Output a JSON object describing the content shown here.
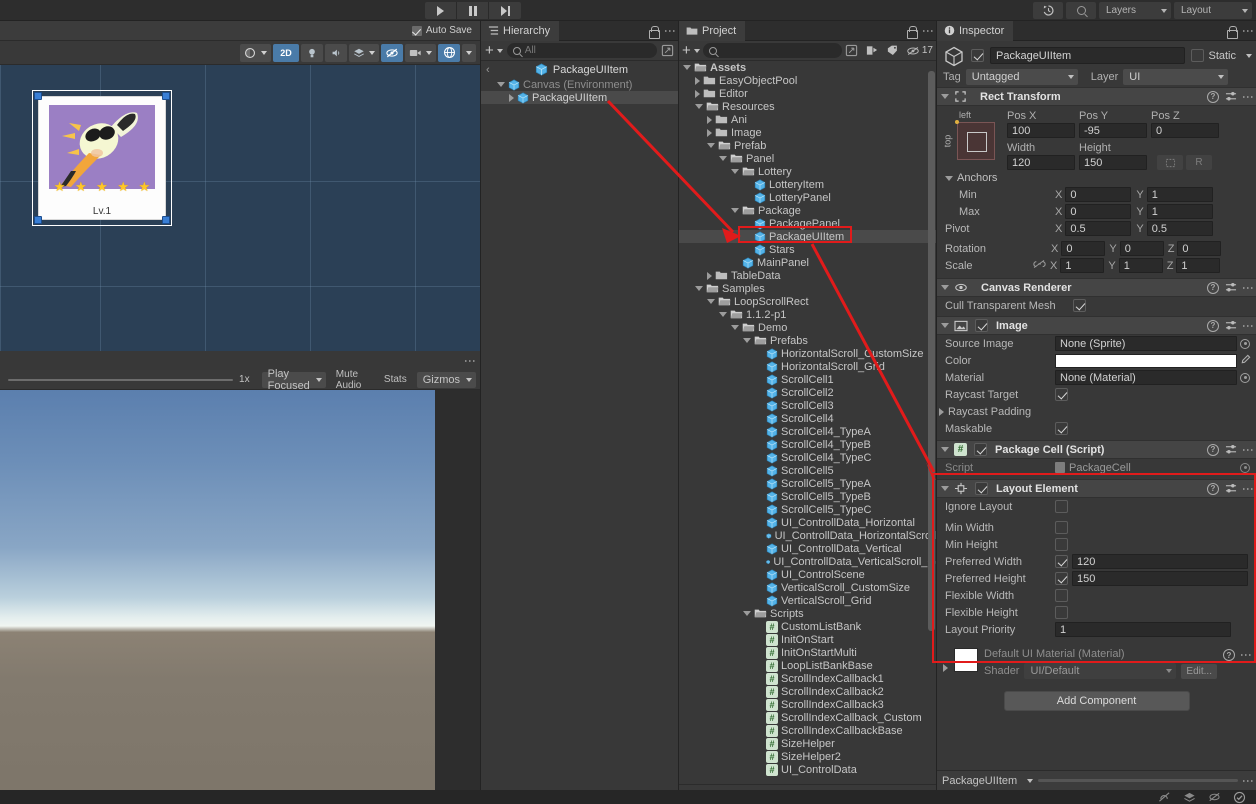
{
  "toolbar": {
    "play_label": "play-button",
    "pause_label": "pause-button",
    "step_label": "step-button",
    "history_icon": "history-icon",
    "search_icon": "search-icon",
    "layers_label": "Layers",
    "layout_label": "Layout"
  },
  "scene": {
    "auto_save_label": "Auto Save",
    "auto_save_checked": true,
    "mode_2d": "2D",
    "card": {
      "level_label": "Lv.1",
      "star_count": 5,
      "star_color": "#ffc727",
      "art_bg": "#9b7fc4"
    }
  },
  "game": {
    "zoom_label": "1x",
    "play_mode": "Play Focused",
    "mute_audio": "Mute Audio",
    "stats": "Stats",
    "gizmos": "Gizmos"
  },
  "hierarchy": {
    "tab_label": "Hierarchy",
    "search_placeholder": "All",
    "prefab_root": "PackageUIItem",
    "rows": [
      {
        "label": "Canvas (Environment)",
        "depth": 1,
        "tri": "down",
        "dim": true,
        "selected": false
      },
      {
        "label": "PackageUIItem",
        "depth": 2,
        "tri": "right",
        "dim": false,
        "selected": true
      }
    ]
  },
  "project": {
    "tab_label": "Project",
    "search_placeholder": "",
    "badge_count": "17",
    "rows": [
      {
        "label": "Assets",
        "depth": 0,
        "tri": "down",
        "icon": "folder-open",
        "selected": false
      },
      {
        "label": "EasyObjectPool",
        "depth": 1,
        "tri": "right",
        "icon": "folder",
        "selected": false
      },
      {
        "label": "Editor",
        "depth": 1,
        "tri": "right",
        "icon": "folder",
        "selected": false
      },
      {
        "label": "Resources",
        "depth": 1,
        "tri": "down",
        "icon": "folder-open",
        "selected": false
      },
      {
        "label": "Ani",
        "depth": 2,
        "tri": "right",
        "icon": "folder",
        "selected": false
      },
      {
        "label": "Image",
        "depth": 2,
        "tri": "right",
        "icon": "folder",
        "selected": false
      },
      {
        "label": "Prefab",
        "depth": 2,
        "tri": "down",
        "icon": "folder-open",
        "selected": false
      },
      {
        "label": "Panel",
        "depth": 3,
        "tri": "down",
        "icon": "folder-open",
        "selected": false
      },
      {
        "label": "Lottery",
        "depth": 4,
        "tri": "down",
        "icon": "folder-open",
        "selected": false
      },
      {
        "label": "LotteryItem",
        "depth": 5,
        "tri": "none",
        "icon": "prefab",
        "selected": false
      },
      {
        "label": "LotteryPanel",
        "depth": 5,
        "tri": "none",
        "icon": "prefab",
        "selected": false
      },
      {
        "label": "Package",
        "depth": 4,
        "tri": "down",
        "icon": "folder-open",
        "selected": false
      },
      {
        "label": "PackagePanel",
        "depth": 5,
        "tri": "none",
        "icon": "prefab",
        "selected": false
      },
      {
        "label": "PackageUIItem",
        "depth": 5,
        "tri": "none",
        "icon": "prefab",
        "selected": true
      },
      {
        "label": "Stars",
        "depth": 5,
        "tri": "none",
        "icon": "prefab",
        "selected": false
      },
      {
        "label": "MainPanel",
        "depth": 4,
        "tri": "none",
        "icon": "prefab",
        "selected": false
      },
      {
        "label": "TableData",
        "depth": 2,
        "tri": "right",
        "icon": "folder",
        "selected": false
      },
      {
        "label": "Samples",
        "depth": 1,
        "tri": "down",
        "icon": "folder-open",
        "selected": false
      },
      {
        "label": "LoopScrollRect",
        "depth": 2,
        "tri": "down",
        "icon": "folder-open",
        "selected": false
      },
      {
        "label": "1.1.2-p1",
        "depth": 3,
        "tri": "down",
        "icon": "folder-open",
        "selected": false
      },
      {
        "label": "Demo",
        "depth": 4,
        "tri": "down",
        "icon": "folder-open",
        "selected": false
      },
      {
        "label": "Prefabs",
        "depth": 5,
        "tri": "down",
        "icon": "folder-open",
        "selected": false
      },
      {
        "label": "HorizontalScroll_CustomSize",
        "depth": 6,
        "tri": "none",
        "icon": "prefab",
        "selected": false
      },
      {
        "label": "HorizontalScroll_Grid",
        "depth": 6,
        "tri": "none",
        "icon": "prefab",
        "selected": false
      },
      {
        "label": "ScrollCell1",
        "depth": 6,
        "tri": "none",
        "icon": "prefab",
        "selected": false
      },
      {
        "label": "ScrollCell2",
        "depth": 6,
        "tri": "none",
        "icon": "prefab",
        "selected": false
      },
      {
        "label": "ScrollCell3",
        "depth": 6,
        "tri": "none",
        "icon": "prefab",
        "selected": false
      },
      {
        "label": "ScrollCell4",
        "depth": 6,
        "tri": "none",
        "icon": "prefab",
        "selected": false
      },
      {
        "label": "ScrollCell4_TypeA",
        "depth": 6,
        "tri": "none",
        "icon": "prefab",
        "selected": false
      },
      {
        "label": "ScrollCell4_TypeB",
        "depth": 6,
        "tri": "none",
        "icon": "prefab",
        "selected": false
      },
      {
        "label": "ScrollCell4_TypeC",
        "depth": 6,
        "tri": "none",
        "icon": "prefab",
        "selected": false
      },
      {
        "label": "ScrollCell5",
        "depth": 6,
        "tri": "none",
        "icon": "prefab",
        "selected": false
      },
      {
        "label": "ScrollCell5_TypeA",
        "depth": 6,
        "tri": "none",
        "icon": "prefab",
        "selected": false
      },
      {
        "label": "ScrollCell5_TypeB",
        "depth": 6,
        "tri": "none",
        "icon": "prefab",
        "selected": false
      },
      {
        "label": "ScrollCell5_TypeC",
        "depth": 6,
        "tri": "none",
        "icon": "prefab",
        "selected": false
      },
      {
        "label": "UI_ControllData_Horizontal",
        "depth": 6,
        "tri": "none",
        "icon": "prefab",
        "selected": false
      },
      {
        "label": "UI_ControllData_HorizontalScroll",
        "depth": 6,
        "tri": "none",
        "icon": "prefab",
        "selected": false
      },
      {
        "label": "UI_ControllData_Vertical",
        "depth": 6,
        "tri": "none",
        "icon": "prefab",
        "selected": false
      },
      {
        "label": "UI_ControllData_VerticalScroll_G",
        "depth": 6,
        "tri": "none",
        "icon": "prefab",
        "selected": false
      },
      {
        "label": "UI_ControlScene",
        "depth": 6,
        "tri": "none",
        "icon": "prefab",
        "selected": false
      },
      {
        "label": "VerticalScroll_CustomSize",
        "depth": 6,
        "tri": "none",
        "icon": "prefab",
        "selected": false
      },
      {
        "label": "VerticalScroll_Grid",
        "depth": 6,
        "tri": "none",
        "icon": "prefab",
        "selected": false
      },
      {
        "label": "Scripts",
        "depth": 5,
        "tri": "down",
        "icon": "folder-open",
        "selected": false
      },
      {
        "label": "CustomListBank",
        "depth": 6,
        "tri": "none",
        "icon": "script",
        "selected": false
      },
      {
        "label": "InitOnStart",
        "depth": 6,
        "tri": "none",
        "icon": "script",
        "selected": false
      },
      {
        "label": "InitOnStartMulti",
        "depth": 6,
        "tri": "none",
        "icon": "script",
        "selected": false
      },
      {
        "label": "LoopListBankBase",
        "depth": 6,
        "tri": "none",
        "icon": "script",
        "selected": false
      },
      {
        "label": "ScrollIndexCallback1",
        "depth": 6,
        "tri": "none",
        "icon": "script",
        "selected": false
      },
      {
        "label": "ScrollIndexCallback2",
        "depth": 6,
        "tri": "none",
        "icon": "script",
        "selected": false
      },
      {
        "label": "ScrollIndexCallback3",
        "depth": 6,
        "tri": "none",
        "icon": "script",
        "selected": false
      },
      {
        "label": "ScrollIndexCallback_Custom",
        "depth": 6,
        "tri": "none",
        "icon": "script",
        "selected": false
      },
      {
        "label": "ScrollIndexCallbackBase",
        "depth": 6,
        "tri": "none",
        "icon": "script",
        "selected": false
      },
      {
        "label": "SizeHelper",
        "depth": 6,
        "tri": "none",
        "icon": "script",
        "selected": false
      },
      {
        "label": "SizeHelper2",
        "depth": 6,
        "tri": "none",
        "icon": "script",
        "selected": false
      },
      {
        "label": "UI_ControlData",
        "depth": 6,
        "tri": "none",
        "icon": "script",
        "selected": false
      }
    ]
  },
  "inspector": {
    "tab_label": "Inspector",
    "object_name": "PackageUIItem",
    "object_enabled": true,
    "static_label": "Static",
    "tag_label": "Tag",
    "tag_value": "Untagged",
    "layer_label": "Layer",
    "layer_value": "UI",
    "rect_transform": {
      "title": "Rect Transform",
      "anchor_left": "left",
      "anchor_top": "top",
      "pos_x_label": "Pos X",
      "pos_x": "100",
      "pos_y_label": "Pos Y",
      "pos_y": "-95",
      "pos_z_label": "Pos Z",
      "pos_z": "0",
      "width_label": "Width",
      "width": "120",
      "height_label": "Height",
      "height": "150",
      "anchors_label": "Anchors",
      "min_label": "Min",
      "min_x": "0",
      "min_y": "1",
      "max_label": "Max",
      "max_x": "0",
      "max_y": "1",
      "pivot_label": "Pivot",
      "pivot_x": "0.5",
      "pivot_y": "0.5",
      "rotation_label": "Rotation",
      "rot_x": "0",
      "rot_y": "0",
      "rot_z": "0",
      "scale_label": "Scale",
      "scale_x": "1",
      "scale_y": "1",
      "scale_z": "1",
      "blueprint_btn": "blueprint-mode-button",
      "raw_btn": "R"
    },
    "canvas_renderer": {
      "title": "Canvas Renderer",
      "cull_label": "Cull Transparent Mesh",
      "cull_checked": true
    },
    "image": {
      "title": "Image",
      "enabled": true,
      "source_image_label": "Source Image",
      "source_image_value": "None (Sprite)",
      "color_label": "Color",
      "color_value": "#ffffff",
      "material_label": "Material",
      "material_value": "None (Material)",
      "raycast_target_label": "Raycast Target",
      "raycast_target_checked": true,
      "raycast_padding_label": "Raycast Padding",
      "maskable_label": "Maskable",
      "maskable_checked": true
    },
    "package_cell": {
      "title": "Package Cell (Script)",
      "enabled": true,
      "script_label": "Script",
      "script_value": "PackageCell"
    },
    "layout_element": {
      "title": "Layout Element",
      "enabled": true,
      "rows": [
        {
          "label": "Ignore Layout",
          "checked": false,
          "value": null
        },
        {
          "label": "Min Width",
          "checked": false,
          "value": null
        },
        {
          "label": "Min Height",
          "checked": false,
          "value": null
        },
        {
          "label": "Preferred Width",
          "checked": true,
          "value": "120"
        },
        {
          "label": "Preferred Height",
          "checked": true,
          "value": "150"
        },
        {
          "label": "Flexible Width",
          "checked": false,
          "value": null
        },
        {
          "label": "Flexible Height",
          "checked": false,
          "value": null
        }
      ],
      "priority_label": "Layout Priority",
      "priority_value": "1"
    },
    "material_preview": {
      "title": "Default UI Material (Material)",
      "shader_label": "Shader",
      "shader_value": "UI/Default",
      "edit_label": "Edit..."
    },
    "add_component_label": "Add Component",
    "footer_object": "PackageUIItem"
  },
  "annotation": {
    "accent_color": "#e11b1b"
  }
}
